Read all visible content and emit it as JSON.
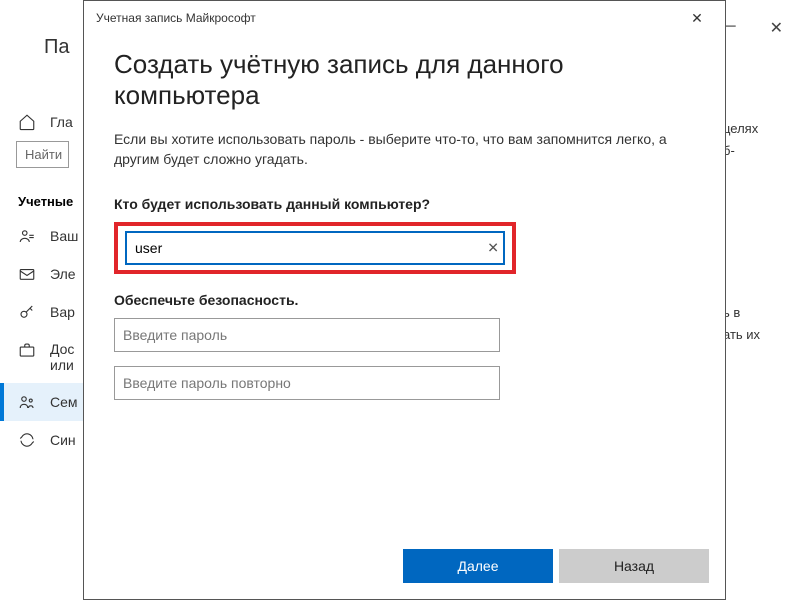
{
  "background": {
    "back_label": "Па",
    "home_label": "Гла",
    "search_placeholder": "Найти",
    "section_heading": "Учетные",
    "nav": [
      {
        "icon": "user",
        "label": "Ваш"
      },
      {
        "icon": "mail",
        "label": "Эле"
      },
      {
        "icon": "key",
        "label": "Вар"
      },
      {
        "icon": "briefcase",
        "label": "Дос",
        "extra": "или"
      },
      {
        "icon": "family",
        "label": "Сем"
      },
      {
        "icon": "sync",
        "label": "Син"
      }
    ],
    "right_text_1": "целях",
    "right_text_2": "б-",
    "right_text_3": "ь в",
    "right_text_4": "ать их"
  },
  "dialog": {
    "titlebar": "Учетная запись Майкрософт",
    "heading": "Создать учётную запись для данного компьютера",
    "description": "Если вы хотите использовать пароль - выберите что-то, что вам запомнится легко, а другим будет сложно угадать.",
    "question": "Кто будет использовать данный компьютер?",
    "username_value": "user",
    "security_label": "Обеспечьте безопасность.",
    "password_placeholder": "Введите пароль",
    "password_confirm_placeholder": "Введите пароль повторно",
    "next_label": "Далее",
    "back_label": "Назад"
  }
}
